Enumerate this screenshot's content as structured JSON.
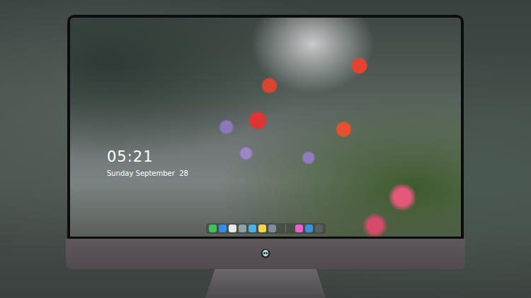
{
  "lock_screen": {
    "time": "05:21",
    "date": "Sunday September  28"
  },
  "dock": {
    "items": [
      {
        "kind": "app",
        "color": "#3cc35a"
      },
      {
        "kind": "app",
        "color": "#2f8ee8"
      },
      {
        "kind": "app",
        "color": "#e8e8e8"
      },
      {
        "kind": "app",
        "color": "#8fa0a8"
      },
      {
        "kind": "app",
        "color": "#46b4e6"
      },
      {
        "kind": "app",
        "color": "#f3d64a"
      },
      {
        "kind": "app",
        "color": "#7d8c96"
      },
      {
        "kind": "separator",
        "color": "#9a9a9a"
      },
      {
        "kind": "app",
        "color": "#e860c8"
      },
      {
        "kind": "app",
        "color": "#3d8fe0"
      },
      {
        "kind": "app",
        "color": "#5c5c62"
      }
    ]
  }
}
